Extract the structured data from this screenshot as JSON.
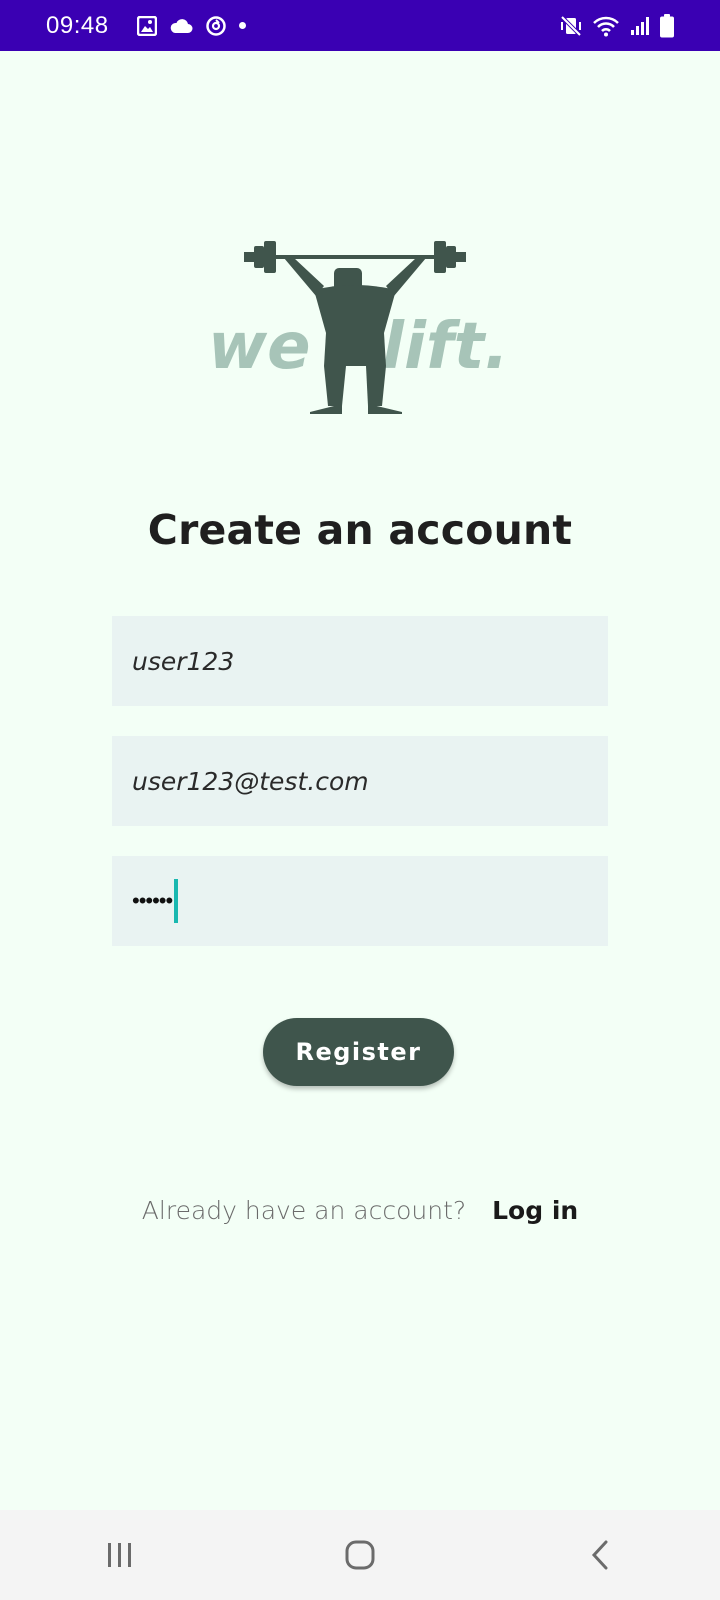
{
  "status_bar": {
    "time": "09:48",
    "icons_left": [
      "image-icon",
      "cloud-icon",
      "sync-icon",
      "dot-icon"
    ],
    "icons_right": [
      "mute-vibrate-icon",
      "wifi-icon",
      "signal-icon",
      "battery-icon"
    ]
  },
  "logo": {
    "text_left": "we",
    "text_right": "lift."
  },
  "form": {
    "title": "Create an account",
    "username_value": "user123",
    "email_value": "user123@test.com",
    "password_masked": "••••••",
    "register_label": "Register"
  },
  "footer": {
    "prompt": "Already have an account?",
    "login_label": "Log in"
  },
  "nav_bar": {
    "buttons": [
      "recents-icon",
      "home-icon",
      "back-icon"
    ]
  },
  "colors": {
    "status_bar": "#3a00b3",
    "background": "#f3fff6",
    "field": "#e9f3f2",
    "button": "#3f554c",
    "logo_dark": "#40554c",
    "logo_light": "#a7c4b8",
    "caret": "#19b8b0"
  }
}
